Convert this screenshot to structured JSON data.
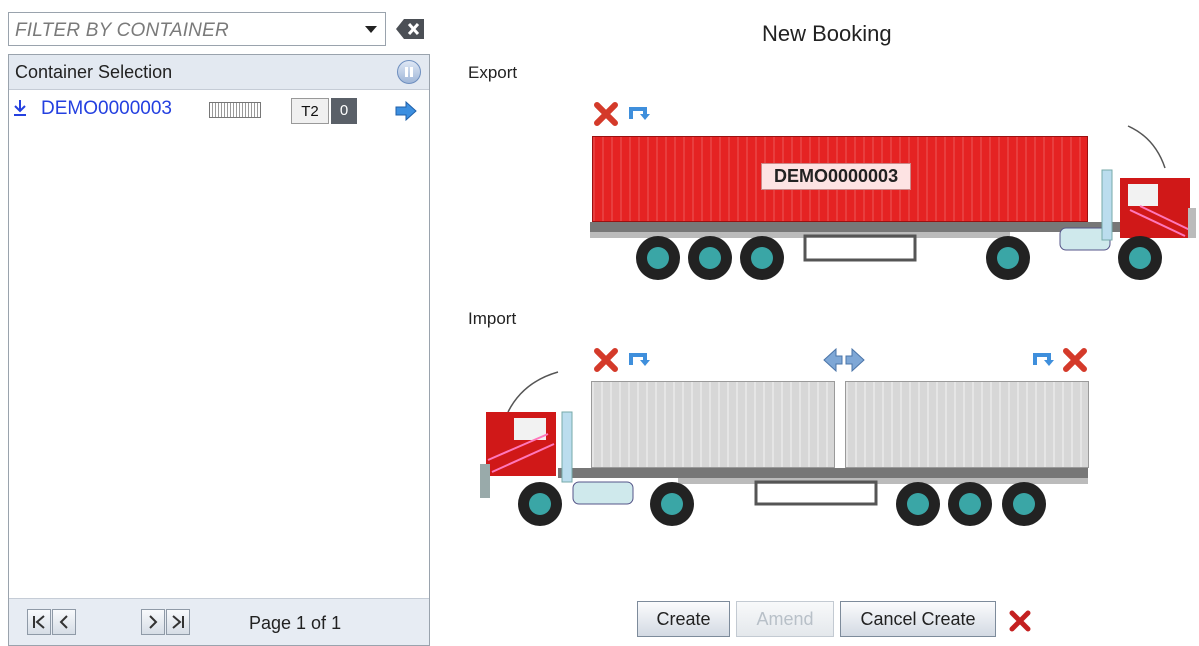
{
  "filter": {
    "placeholder": "FILTER BY CONTAINER"
  },
  "panel": {
    "title": "Container Selection",
    "rows": [
      {
        "container_id": "DEMO0000003",
        "tag": "T2",
        "count": "0"
      }
    ],
    "footer": {
      "page_label": "Page 1 of 1"
    }
  },
  "main": {
    "title": "New Booking",
    "export": {
      "label": "Export",
      "container_label": "DEMO0000003"
    },
    "import": {
      "label": "Import"
    },
    "buttons": {
      "create": "Create",
      "amend": "Amend",
      "cancel_create": "Cancel Create"
    }
  },
  "colors": {
    "export_container": "#e52323",
    "empty_container": "#d7d7d7",
    "truck_cab": "#d01818",
    "link_blue": "#2440e0",
    "delete_red": "#d43a2a",
    "action_blue": "#3f8fdc"
  }
}
